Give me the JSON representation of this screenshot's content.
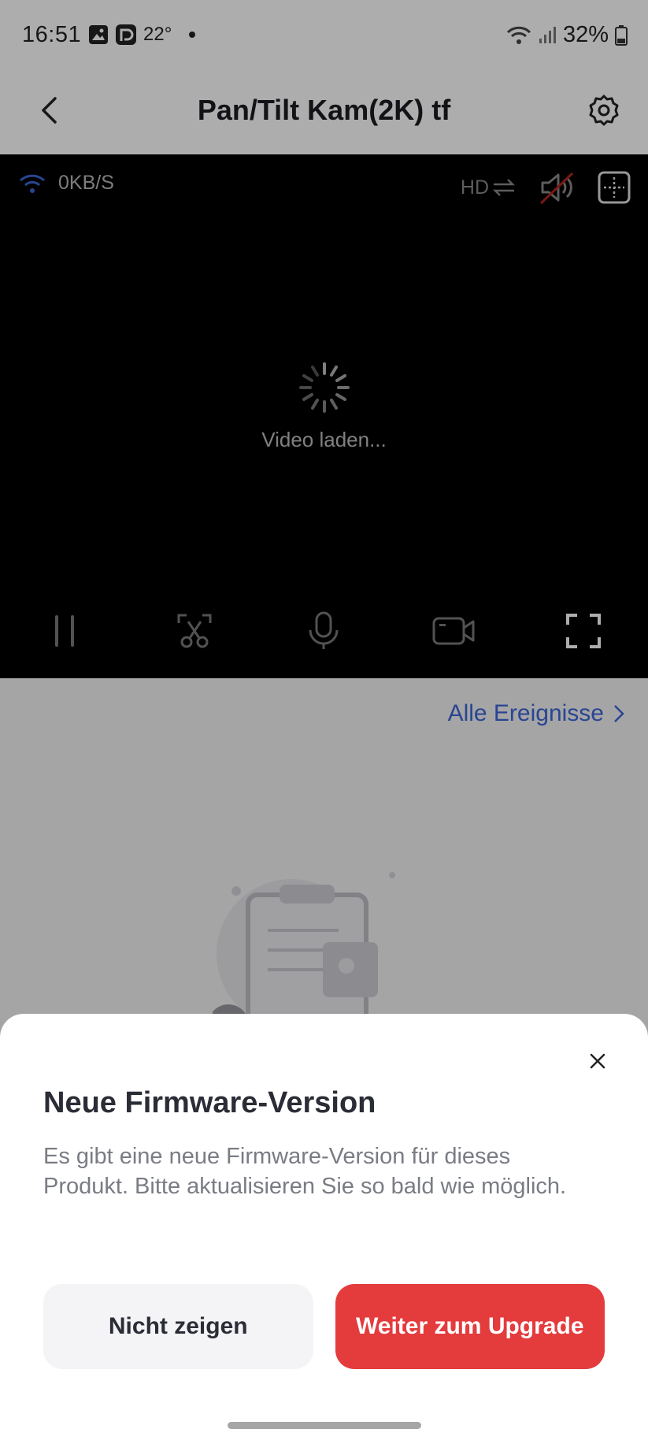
{
  "status_bar": {
    "time": "16:51",
    "temperature": "22°",
    "battery": "32%",
    "icons": [
      "gallery-icon",
      "app-notification-icon",
      "wifi-icon",
      "signal-icon",
      "battery-icon"
    ]
  },
  "header": {
    "title": "Pan/Tilt Kam(2K) tf",
    "back_icon": "chevron-left-icon",
    "settings_icon": "gear-icon"
  },
  "video": {
    "net_speed": "0KB/S",
    "quality_label": "HD",
    "loading_text": "Video laden...",
    "top_icons": [
      "quality-switch-icon",
      "speaker-muted-icon",
      "grid-view-icon"
    ],
    "controls": [
      "pause-icon",
      "screenshot-icon",
      "microphone-icon",
      "record-icon",
      "fullscreen-icon"
    ]
  },
  "events": {
    "all_events_label": "Alle Ereignisse"
  },
  "dialog": {
    "title": "Neue Firmware-Version",
    "body": "Es gibt eine neue Firmware-Version für dieses Produkt. Bitte aktualisieren Sie so bald wie möglich.",
    "secondary_button": "Nicht zeigen",
    "primary_button": "Weiter zum Upgrade"
  },
  "colors": {
    "accent_blue": "#3d66d8",
    "primary_red": "#e43b3d",
    "video_bg": "#000000"
  }
}
